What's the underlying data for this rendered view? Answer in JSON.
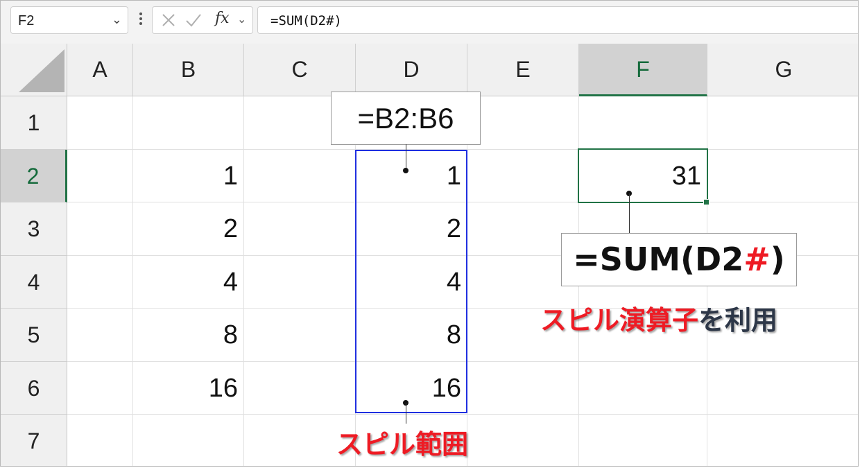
{
  "formula_bar": {
    "name_box": "F2",
    "name_box_dropdown": "⌄",
    "fx_label": "fx",
    "fx_dropdown": "⌄",
    "formula": "=SUM(D2#)"
  },
  "columns": [
    "A",
    "B",
    "C",
    "D",
    "E",
    "F",
    "G"
  ],
  "rows": [
    "1",
    "2",
    "3",
    "4",
    "5",
    "6",
    "7"
  ],
  "selected_cell": {
    "column": "F",
    "row": "2"
  },
  "cells": {
    "B2": "1",
    "B3": "2",
    "B4": "4",
    "B5": "8",
    "B6": "16",
    "D2": "1",
    "D3": "2",
    "D4": "4",
    "D5": "8",
    "D6": "16",
    "F2": "31"
  },
  "annotations": {
    "spill_formula": "=B2:B6",
    "sum_formula_prefix": "=SUM(D2",
    "sum_formula_hash": "#",
    "sum_formula_suffix": ")",
    "spill_range_label": "スピル範囲",
    "spill_operator_label_red": "スピル演算子",
    "spill_operator_label_dark": "を利用"
  },
  "colors": {
    "spill_border": "#1f2fe0",
    "selection_green": "#217346",
    "label_red": "#ee1b24",
    "label_dark": "#2d3748"
  }
}
